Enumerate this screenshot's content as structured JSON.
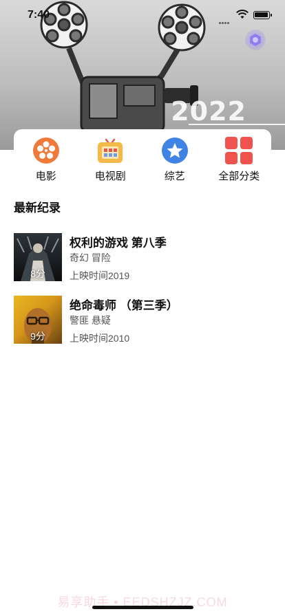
{
  "status_bar": {
    "time": "7:40"
  },
  "hero": {
    "year_text": "2022"
  },
  "categories": [
    {
      "label": "电影",
      "icon": "film-reel-icon",
      "color": "#f07a3a"
    },
    {
      "label": "电视剧",
      "icon": "tv-icon",
      "color": "#f5b94a"
    },
    {
      "label": "综艺",
      "icon": "star-icon",
      "color": "#3f84e5"
    },
    {
      "label": "全部分类",
      "icon": "grid-icon",
      "color": "#f0534e"
    }
  ],
  "latest": {
    "title": "最新纪录",
    "items": [
      {
        "title": "权利的游戏 第八季",
        "genres": "奇幻 冒险",
        "release": "上映时间2019",
        "score": "8分"
      },
      {
        "title": "绝命毒师 （第三季）",
        "genres": "警匪 悬疑",
        "release": "上映时间2010",
        "score": "9分"
      }
    ]
  },
  "watermark": "易享助手 • EEDSHZJZ.COM"
}
